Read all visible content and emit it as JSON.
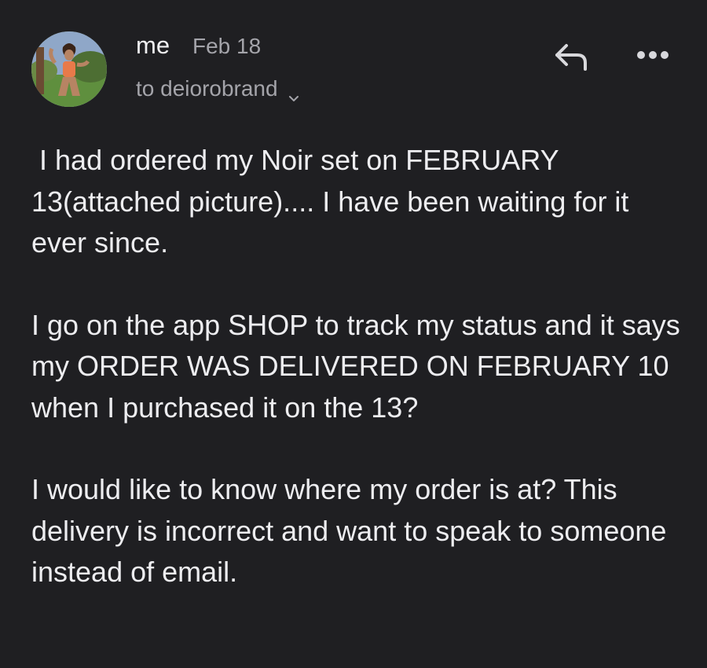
{
  "message": {
    "sender": "me",
    "date": "Feb 18",
    "recipient": "to deiorobrand",
    "avatar": "profile-photo",
    "actions": {
      "reply_icon": "reply-icon",
      "more_icon": "more-options-icon"
    },
    "body": [
      " I had ordered my Noir set on FEBRUARY 13(attached picture).... I have been waiting for it ever since.",
      "I go on the app SHOP to track my status and it says my ORDER WAS DELIVERED ON FEBRUARY 10 when I purchased it on the 13?",
      "I would like to know where my order is at? This delivery is incorrect and want to speak to someone instead of email."
    ]
  }
}
